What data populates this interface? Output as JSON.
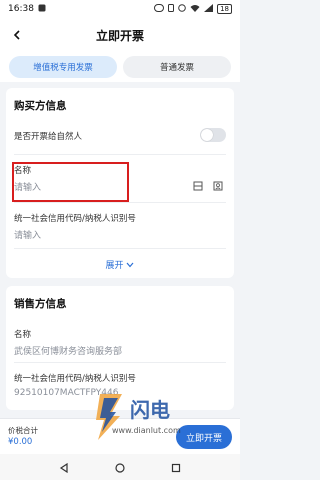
{
  "status": {
    "time": "16:38",
    "battery": "18"
  },
  "header": {
    "title": "立即开票"
  },
  "tabs": [
    {
      "label": "增值税专用发票",
      "active": true
    },
    {
      "label": "普通发票",
      "active": false
    }
  ],
  "buyer": {
    "title": "购买方信息",
    "natural_person_label": "是否开票给自然人",
    "natural_person_on": false,
    "name_label": "名称",
    "name_placeholder": "请输入",
    "tax_id_label": "统一社会信用代码/纳税人识别号",
    "tax_id_placeholder": "请输入",
    "expand_label": "展开"
  },
  "seller": {
    "title": "销售方信息",
    "name_label": "名称",
    "name_value": "武侯区何博财务咨询服务部",
    "tax_id_label": "统一社会信用代码/纳税人识别号",
    "tax_id_value": "92510107MACTFPY446"
  },
  "footer": {
    "total_label": "价税合计",
    "amount": "¥0.00",
    "submit_label": "立即开票"
  },
  "watermark": {
    "text_main": "闪电",
    "text_url": "www.dianlut.com"
  },
  "colors": {
    "accent": "#2a6fd6",
    "highlight": "#d81e1e"
  },
  "icons": [
    "back-icon",
    "scan-icon",
    "contact-icon",
    "chevron-down-icon"
  ]
}
